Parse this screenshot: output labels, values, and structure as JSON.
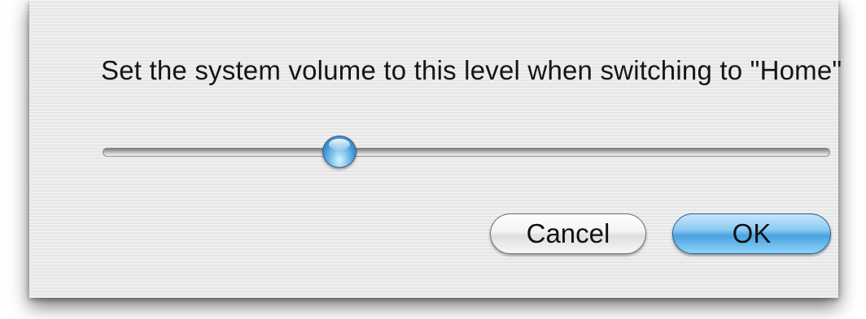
{
  "dialog": {
    "message": "Set the system volume to this level when switching to \"Home\"",
    "volume_level_fraction": 0.325,
    "buttons": {
      "cancel_label": "Cancel",
      "ok_label": "OK"
    },
    "colors": {
      "default_button": "#4aa2e2",
      "thumb": "#3e8fd0",
      "background": "#ececec"
    }
  }
}
